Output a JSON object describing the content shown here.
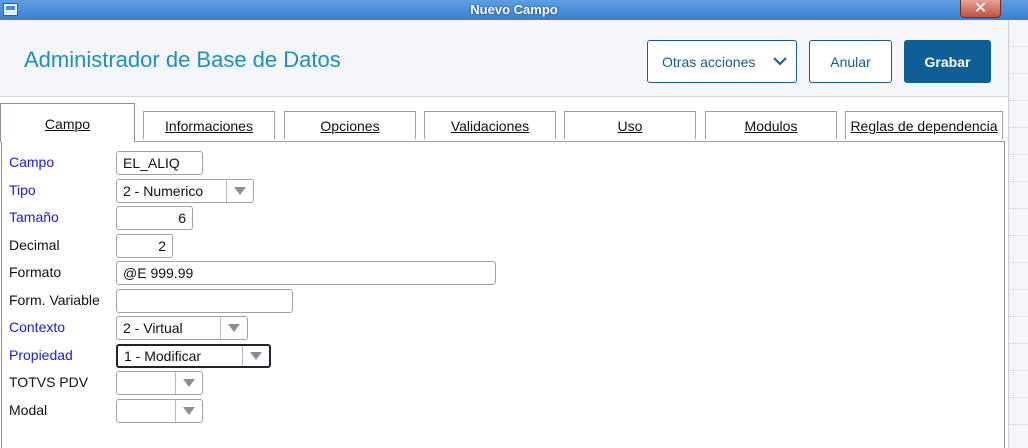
{
  "window": {
    "title": "Nuevo Campo",
    "close_label": "✕"
  },
  "header": {
    "heading": "Administrador de Base de Datos",
    "buttons": {
      "otras": "Otras acciones",
      "anular": "Anular",
      "grabar": "Grabar"
    }
  },
  "tabs": [
    {
      "label": "Campo",
      "active": true
    },
    {
      "label": "Informaciones"
    },
    {
      "label": "Opciones"
    },
    {
      "label": "Validaciones"
    },
    {
      "label": "Uso"
    },
    {
      "label": "Modulos"
    },
    {
      "label": "Reglas de dependencia"
    }
  ],
  "form": {
    "campo": {
      "label": "Campo",
      "value": "EL_ALIQ"
    },
    "tipo": {
      "label": "Tipo",
      "value": "2 - Numerico"
    },
    "tamano": {
      "label": "Tamaño",
      "value": "6"
    },
    "decimal": {
      "label": "Decimal",
      "value": "2"
    },
    "formato": {
      "label": "Formato",
      "value": "@E 999.99"
    },
    "form_variable": {
      "label": "Form. Variable",
      "value": ""
    },
    "contexto": {
      "label": "Contexto",
      "value": "2 - Virtual"
    },
    "propiedad": {
      "label": "Propiedad",
      "value": "1 - Modificar"
    },
    "totvs_pdv": {
      "label": "TOTVS PDV",
      "value": ""
    },
    "modal": {
      "label": "Modal",
      "value": ""
    }
  },
  "colors": {
    "accent": "#1e8fc0",
    "primary_button": "#0f5e95",
    "required_label": "#1b1bd4"
  }
}
